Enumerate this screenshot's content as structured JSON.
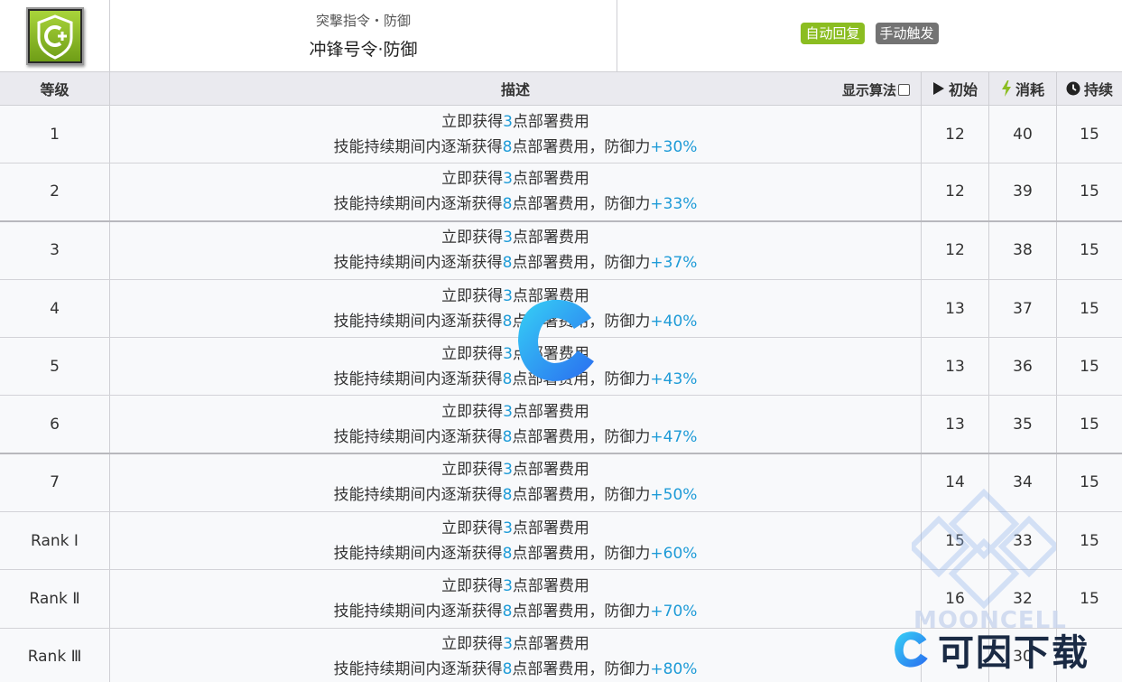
{
  "header": {
    "subtitle": "突撃指令・防御",
    "title": "冲锋号令·防御",
    "tags": [
      "自动回复",
      "手动触发"
    ]
  },
  "table": {
    "columns": {
      "level": "等级",
      "description": "描述",
      "show_formula": "显示算法",
      "initial": "初始",
      "cost": "消耗",
      "duration": "持续"
    },
    "rows": [
      {
        "level": "1",
        "line1_pre": "立即获得",
        "line1_num": "3",
        "line1_post": "点部署费用",
        "line2_pre": "技能持续期间内逐渐获得",
        "line2_num": "8",
        "line2_mid": "点部署费用，防御力",
        "line2_val": "+30%",
        "initial": "12",
        "cost": "40",
        "duration": "15"
      },
      {
        "level": "2",
        "line1_pre": "立即获得",
        "line1_num": "3",
        "line1_post": "点部署费用",
        "line2_pre": "技能持续期间内逐渐获得",
        "line2_num": "8",
        "line2_mid": "点部署费用，防御力",
        "line2_val": "+33%",
        "initial": "12",
        "cost": "39",
        "duration": "15"
      },
      {
        "level": "3",
        "line1_pre": "立即获得",
        "line1_num": "3",
        "line1_post": "点部署费用",
        "line2_pre": "技能持续期间内逐渐获得",
        "line2_num": "8",
        "line2_mid": "点部署费用，防御力",
        "line2_val": "+37%",
        "initial": "12",
        "cost": "38",
        "duration": "15"
      },
      {
        "level": "4",
        "line1_pre": "立即获得",
        "line1_num": "3",
        "line1_post": "点部署费用",
        "line2_pre": "技能持续期间内逐渐获得",
        "line2_num": "8",
        "line2_mid": "点部署费用，防御力",
        "line2_val": "+40%",
        "initial": "13",
        "cost": "37",
        "duration": "15"
      },
      {
        "level": "5",
        "line1_pre": "立即获得",
        "line1_num": "3",
        "line1_post": "点部署费用",
        "line2_pre": "技能持续期间内逐渐获得",
        "line2_num": "8",
        "line2_mid": "点部署费用，防御力",
        "line2_val": "+43%",
        "initial": "13",
        "cost": "36",
        "duration": "15"
      },
      {
        "level": "6",
        "line1_pre": "立即获得",
        "line1_num": "3",
        "line1_post": "点部署费用",
        "line2_pre": "技能持续期间内逐渐获得",
        "line2_num": "8",
        "line2_mid": "点部署费用，防御力",
        "line2_val": "+47%",
        "initial": "13",
        "cost": "35",
        "duration": "15"
      },
      {
        "level": "7",
        "line1_pre": "立即获得",
        "line1_num": "3",
        "line1_post": "点部署费用",
        "line2_pre": "技能持续期间内逐渐获得",
        "line2_num": "8",
        "line2_mid": "点部署费用，防御力",
        "line2_val": "+50%",
        "initial": "14",
        "cost": "34",
        "duration": "15"
      },
      {
        "level": "Rank Ⅰ",
        "line1_pre": "立即获得",
        "line1_num": "3",
        "line1_post": "点部署费用",
        "line2_pre": "技能持续期间内逐渐获得",
        "line2_num": "8",
        "line2_mid": "点部署费用，防御力",
        "line2_val": "+60%",
        "initial": "15",
        "cost": "33",
        "duration": "15"
      },
      {
        "level": "Rank Ⅱ",
        "line1_pre": "立即获得",
        "line1_num": "3",
        "line1_post": "点部署费用",
        "line2_pre": "技能持续期间内逐渐获得",
        "line2_num": "8",
        "line2_mid": "点部署费用，防御力",
        "line2_val": "+70%",
        "initial": "16",
        "cost": "32",
        "duration": "15"
      },
      {
        "level": "Rank Ⅲ",
        "line1_pre": "立即获得",
        "line1_num": "3",
        "line1_post": "点部署费用",
        "line2_pre": "技能持续期间内逐渐获得",
        "line2_num": "8",
        "line2_mid": "点部署费用，防御力",
        "line2_val": "+80%",
        "initial": "",
        "cost": "30",
        "duration": ""
      }
    ]
  },
  "watermark": {
    "brand": "可因下载",
    "site": "MOONCELL"
  },
  "colors": {
    "highlight": "#1e9bd7",
    "tag_auto": "#8bbd21",
    "tag_manual": "#737373",
    "header_bg": "#eaeaef",
    "cost_icon": "#8bbd21"
  },
  "icons": [
    "skill-icon",
    "play-icon",
    "lightning-icon",
    "clock-icon"
  ]
}
